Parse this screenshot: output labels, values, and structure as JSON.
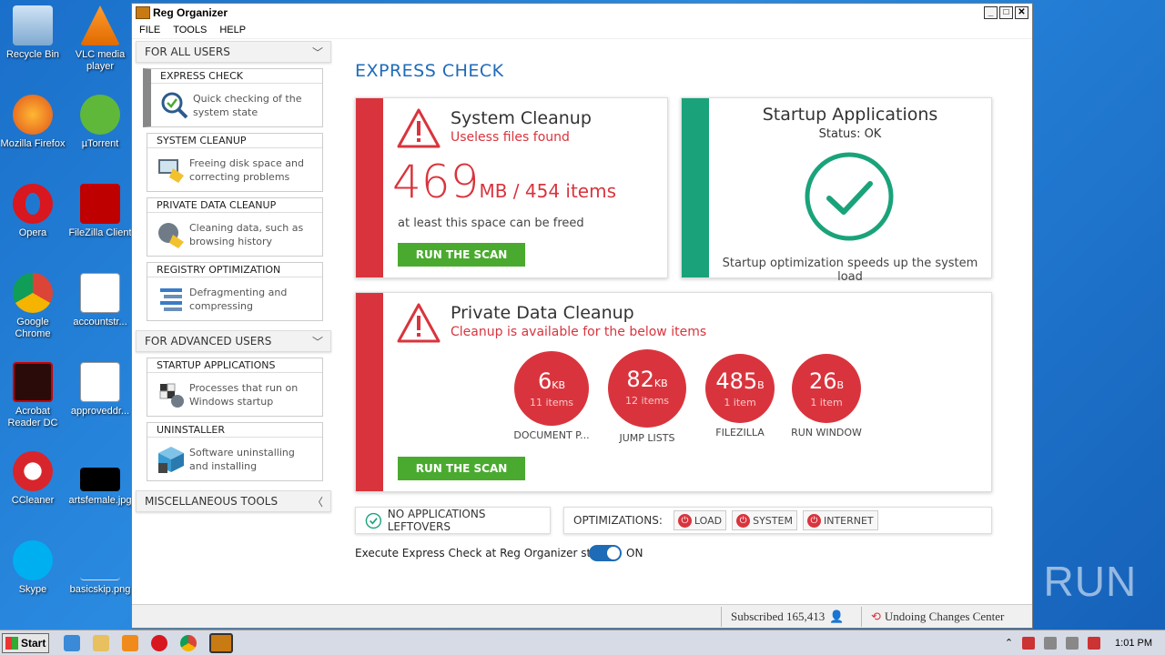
{
  "desktop": {
    "icons": [
      {
        "label": "Recycle Bin"
      },
      {
        "label": "VLC media player"
      },
      {
        "label": "Mozilla Firefox"
      },
      {
        "label": "µTorrent"
      },
      {
        "label": "Opera"
      },
      {
        "label": "FileZilla Client"
      },
      {
        "label": "Google Chrome"
      },
      {
        "label": "accountstr..."
      },
      {
        "label": "Acrobat Reader DC"
      },
      {
        "label": "approveddr..."
      },
      {
        "label": "CCleaner"
      },
      {
        "label": "artsfemale.jpg"
      },
      {
        "label": "Skype"
      },
      {
        "label": "basicskip.png"
      }
    ]
  },
  "window": {
    "title": "Reg Organizer",
    "menu": [
      "FILE",
      "TOOLS",
      "HELP"
    ]
  },
  "sidebar": {
    "section1": "FOR ALL USERS",
    "section2": "FOR ADVANCED USERS",
    "section3": "MISCELLANEOUS TOOLS",
    "items": [
      {
        "title": "EXPRESS CHECK",
        "desc1": "Quick checking of the",
        "desc2": "system state"
      },
      {
        "title": "SYSTEM CLEANUP",
        "desc1": "Freeing disk space and",
        "desc2": "correcting problems"
      },
      {
        "title": "PRIVATE DATA CLEANUP",
        "desc1": "Cleaning data, such as",
        "desc2": "browsing history"
      },
      {
        "title": "REGISTRY OPTIMIZATION",
        "desc1": "Defragmenting and",
        "desc2": "compressing"
      },
      {
        "title": "STARTUP APPLICATIONS",
        "desc1": "Processes that run on",
        "desc2": "Windows startup"
      },
      {
        "title": "UNINSTALLER",
        "desc1": "Software uninstalling",
        "desc2": "and installing"
      }
    ]
  },
  "main": {
    "title": "EXPRESS CHECK",
    "system_cleanup": {
      "title": "System Cleanup",
      "subtitle": "Useless files found",
      "size": "469",
      "unit": "MB / 454 items",
      "note": "at least this space can be freed",
      "button": "RUN THE SCAN"
    },
    "startup": {
      "title": "Startup Applications",
      "status": "Status: OK",
      "note": "Startup optimization speeds up the system load"
    },
    "private_data": {
      "title": "Private Data Cleanup",
      "subtitle": "Cleanup is available for the below items",
      "button": "RUN THE SCAN",
      "bubbles": [
        {
          "value": "6",
          "unit": "KB",
          "count": "11 items",
          "label": "DOCUMENT P..."
        },
        {
          "value": "82",
          "unit": "KB",
          "count": "12 items",
          "label": "JUMP LISTS"
        },
        {
          "value": "485",
          "unit": "B",
          "count": "1 item",
          "label": "FILEZILLA"
        },
        {
          "value": "26",
          "unit": "B",
          "count": "1 item",
          "label": "RUN WINDOW"
        }
      ]
    },
    "leftovers": "NO APPLICATIONS LEFTOVERS",
    "optimizations": {
      "label": "OPTIMIZATIONS:",
      "buttons": [
        "LOAD",
        "SYSTEM",
        "INTERNET"
      ]
    },
    "startup_toggle": {
      "label": "Execute Express Check at Reg Organizer startup",
      "state": "ON"
    }
  },
  "statusbar": {
    "subscribed": "Subscribed 165,413",
    "undo": "Undoing Changes Center"
  },
  "taskbar": {
    "start": "Start",
    "clock": "1:01 PM"
  },
  "watermark": "ANY RUN",
  "colors": {
    "accent_blue": "#1e6bb8",
    "warning_red": "#d9343d",
    "ok_green": "#1aa37a",
    "button_green": "#4aaa2f"
  }
}
